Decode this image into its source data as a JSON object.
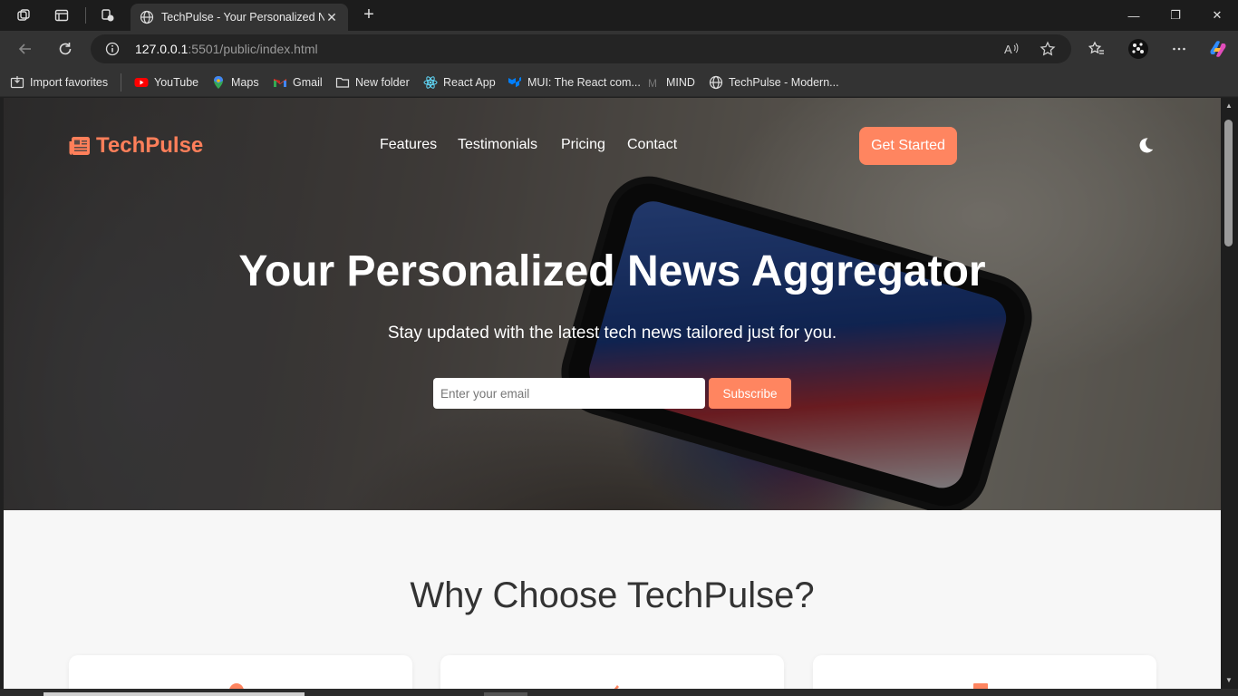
{
  "browser": {
    "tab": {
      "title": "TechPulse - Your Personalized News Aggregator",
      "close_glyph": "✕"
    },
    "new_tab_glyph": "+",
    "window_controls": {
      "minimize": "—",
      "maximize": "❐",
      "close": "✕"
    },
    "address": {
      "host": "127.0.0.1",
      "path": ":5501/public/index.html"
    },
    "bookmarks": [
      {
        "label": "Import favorites",
        "icon": "import-icon"
      },
      {
        "label": "YouTube",
        "icon": "youtube-icon"
      },
      {
        "label": "Maps",
        "icon": "maps-icon"
      },
      {
        "label": "Gmail",
        "icon": "gmail-icon"
      },
      {
        "label": "New folder",
        "icon": "folder-icon"
      },
      {
        "label": "React App",
        "icon": "react-icon"
      },
      {
        "label": "MUI: The React com...",
        "icon": "mui-icon"
      },
      {
        "label": "MIND",
        "icon": "mind-icon"
      },
      {
        "label": "TechPulse - Modern...",
        "icon": "globe-icon"
      }
    ]
  },
  "site": {
    "logo": "TechPulse",
    "nav": [
      "Features",
      "Testimonials",
      "Pricing",
      "Contact"
    ],
    "cta": "Get Started",
    "hero": {
      "title": "Your Personalized News Aggregator",
      "subtitle": "Stay updated with the latest tech news tailored just for you.",
      "email_placeholder": "Enter your email",
      "subscribe": "Subscribe"
    },
    "section_title": "Why Choose TechPulse?",
    "colors": {
      "accent": "#ff8560",
      "logo": "#ff7f5a",
      "text_dark": "#333333"
    }
  }
}
